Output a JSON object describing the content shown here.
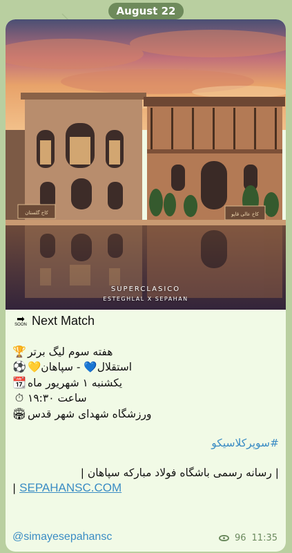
{
  "date_label": "August 22",
  "photo": {
    "watermark_title": "SUPERCLASICO",
    "watermark_subtitle": "ESTEGHLAL X SEPAHAN",
    "sign_left": "کاخ گلستان",
    "sign_right": "کاخ عالی قاپو"
  },
  "post": {
    "heading_icon": "soon-arrow-icon",
    "heading_soon": "SOON",
    "heading": "Next Match",
    "lines": [
      {
        "icon": "🏆",
        "icon_name": "trophy-icon",
        "text": "هفته سوم لیگ برتر"
      },
      {
        "icon": "⚽",
        "icon_name": "soccer-ball-icon",
        "text": "استقلال💙 - سپاهان💛"
      },
      {
        "icon": "📆",
        "icon_name": "calendar-icon",
        "text": "یکشنبه ۱ شهریور ماه"
      },
      {
        "icon": "⏱",
        "icon_name": "stopwatch-icon",
        "text": "ساعت ۱۹:۳۰"
      },
      {
        "icon": "🏟",
        "icon_name": "stadium-icon",
        "text": "ورزشگاه شهدای شهر قدس"
      }
    ],
    "hashtag": "#سوپرکلاسیکو",
    "footer_text": "| رسانه رسمی باشگاه فولاد مبارکه سپاهان |",
    "footer_link": "SEPAHANSC.COM",
    "footer_bar": "|"
  },
  "channel_handle": "@simayesepahansc",
  "views": "96",
  "time": "11:35",
  "colors": {
    "accent": "#3a8cc4",
    "bubble": "#f1fae6",
    "background": "#b9cfa0"
  }
}
